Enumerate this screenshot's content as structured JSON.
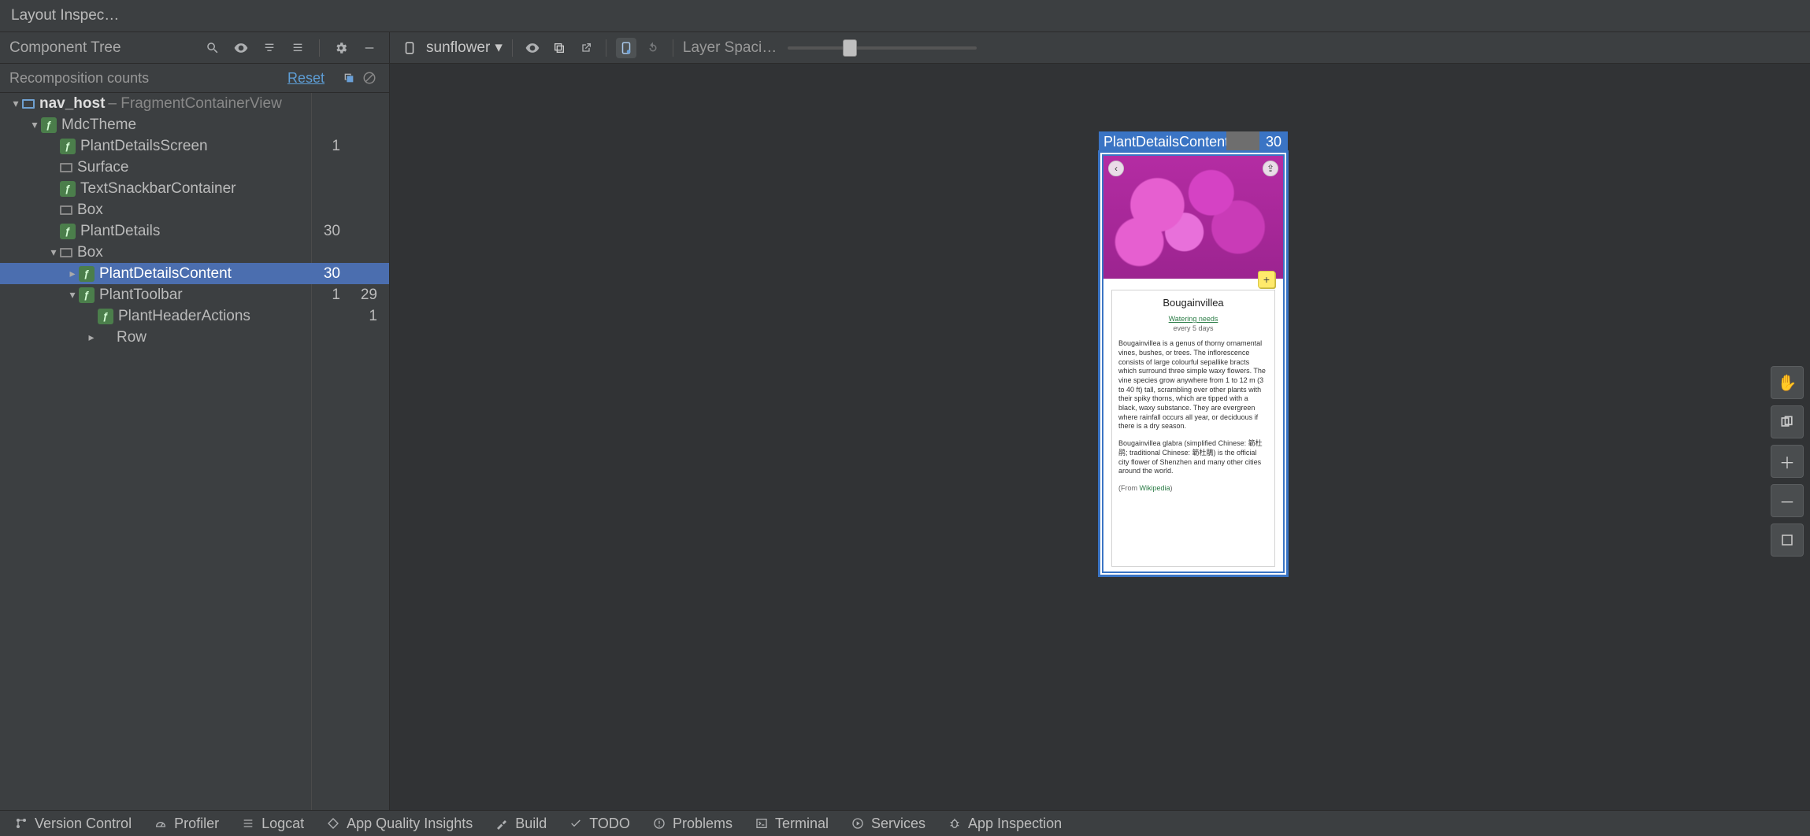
{
  "title_bar": {
    "title": "Layout Inspec…"
  },
  "left": {
    "header": {
      "title": "Component Tree"
    },
    "recomposition": {
      "label": "Recomposition counts",
      "reset": "Reset"
    }
  },
  "tree": [
    {
      "id": "nav_host",
      "depth": 0,
      "chev": "down",
      "icon": "frag",
      "name": "nav_host",
      "meta": " – FragmentContainerView",
      "bold": true
    },
    {
      "id": "MdcTheme",
      "depth": 1,
      "chev": "down",
      "icon": "compose",
      "name": "MdcTheme"
    },
    {
      "id": "PlantDetailsScreen",
      "depth": 2,
      "chev": "none",
      "icon": "compose",
      "name": "PlantDetailsScreen",
      "c1": "1"
    },
    {
      "id": "Surface",
      "depth": 2,
      "chev": "none",
      "icon": "box",
      "name": "Surface"
    },
    {
      "id": "TextSnackbarContainer",
      "depth": 2,
      "chev": "none",
      "icon": "compose",
      "name": "TextSnackbarContainer"
    },
    {
      "id": "Box1",
      "depth": 2,
      "chev": "none",
      "icon": "box",
      "name": "Box"
    },
    {
      "id": "PlantDetails",
      "depth": 2,
      "chev": "none",
      "icon": "compose",
      "name": "PlantDetails",
      "c1": "30"
    },
    {
      "id": "Box2",
      "depth": 2,
      "chev": "down",
      "icon": "box",
      "name": "Box"
    },
    {
      "id": "PlantDetailsContent",
      "depth": 3,
      "chev": "right",
      "icon": "compose",
      "name": "PlantDetailsContent",
      "c1": "30",
      "selected": true
    },
    {
      "id": "PlantToolbar",
      "depth": 3,
      "chev": "down",
      "icon": "compose",
      "name": "PlantToolbar",
      "c1": "1",
      "c2": "29"
    },
    {
      "id": "PlantHeaderActions",
      "depth": 4,
      "chev": "none",
      "icon": "compose",
      "name": "PlantHeaderActions",
      "c2": "1"
    },
    {
      "id": "Row",
      "depth": 4,
      "chev": "right",
      "icon": "row",
      "name": "Row"
    }
  ],
  "right_toolbar": {
    "device": "sunflower",
    "layer_label": "Layer Spaci…",
    "slider_pct": 33
  },
  "selection_overlay": {
    "label": "PlantDetailsContent",
    "badge": "30"
  },
  "device_content": {
    "title": "Bougainvillea",
    "watering_label": "Watering needs",
    "watering_value": "every 5 days",
    "para1": "Bougainvillea is a genus of thorny ornamental vines, bushes, or trees. The inflorescence consists of large colourful sepallike bracts which surround three simple waxy flowers. The vine species grow anywhere from 1 to 12 m (3 to 40 ft) tall, scrambling over other plants with their spiky thorns, which are tipped with a black, waxy substance. They are evergreen where rainfall occurs all year, or deciduous if there is a dry season.",
    "para2": "Bougainvillea glabra (simplified Chinese: 簕杜鹃; traditional Chinese: 簕杜鵑) is the official city flower of Shenzhen and many other cities around the world.",
    "source_prefix": "(From ",
    "source_link": "Wikipedia",
    "source_suffix": ")"
  },
  "bottom_bar": [
    {
      "id": "version-control",
      "label": "Version Control",
      "icon": "branch"
    },
    {
      "id": "profiler",
      "label": "Profiler",
      "icon": "gauge"
    },
    {
      "id": "logcat",
      "label": "Logcat",
      "icon": "list"
    },
    {
      "id": "app-quality",
      "label": "App Quality Insights",
      "icon": "diamond"
    },
    {
      "id": "build",
      "label": "Build",
      "icon": "hammer"
    },
    {
      "id": "todo",
      "label": "TODO",
      "icon": "check"
    },
    {
      "id": "problems",
      "label": "Problems",
      "icon": "warn"
    },
    {
      "id": "terminal",
      "label": "Terminal",
      "icon": "term"
    },
    {
      "id": "services",
      "label": "Services",
      "icon": "play"
    },
    {
      "id": "app-inspection",
      "label": "App Inspection",
      "icon": "bug"
    }
  ]
}
